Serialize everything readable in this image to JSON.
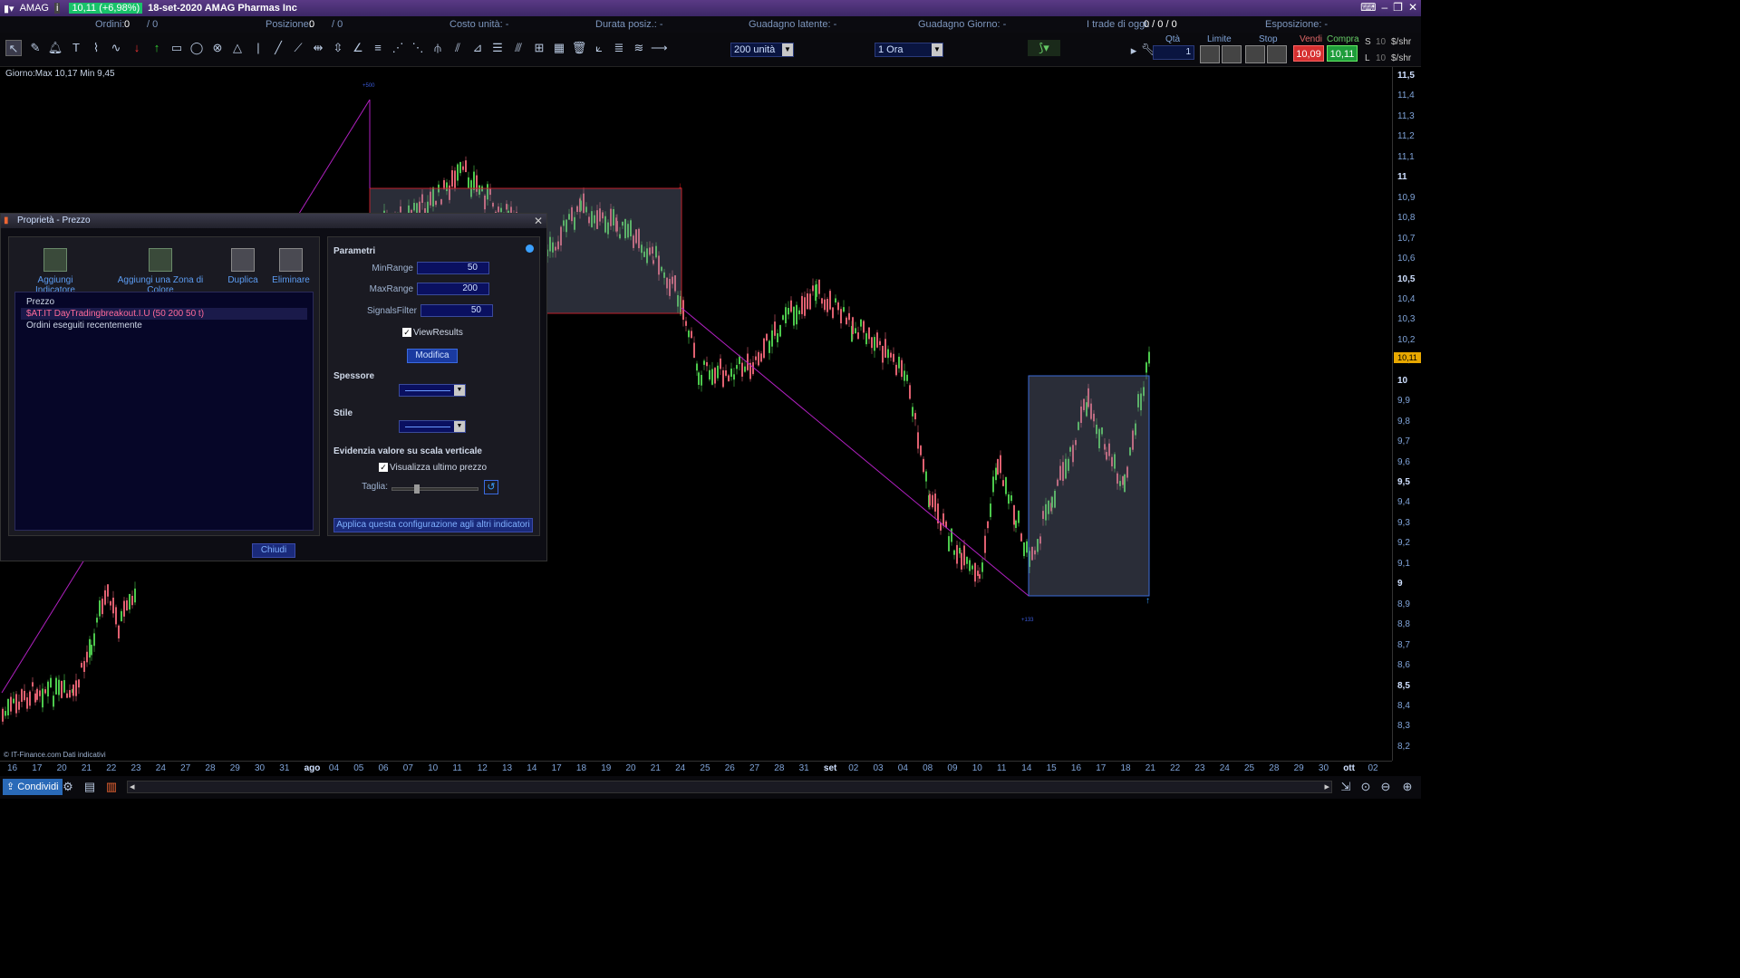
{
  "titlebar": {
    "symbol": "AMAG",
    "price_change": "10,11 (+6,98%)",
    "title": "18-set-2020 AMAG Pharmas Inc"
  },
  "statusbar": {
    "orders_label": "Ordini:",
    "orders_value": "0",
    "orders_total": "/ 0",
    "position_label": "Posizione:",
    "position_value": "0",
    "position_total": "/ 0",
    "unit_cost": "Costo unità: -",
    "duration": "Durata posiz.: -",
    "unrealized": "Guadagno latente: -",
    "day_gain": "Guadagno Giorno: -",
    "trades_label": "I trade di oggi:",
    "trades_value": "0 / 0 / 0",
    "exposure": "Esposizione: -"
  },
  "toolbar": {
    "units_value": "200 unità",
    "timeframe_value": "1 Ora"
  },
  "order_panel": {
    "qty_label": "Qtà",
    "qty_value": "1",
    "limit_label": "Limite",
    "stop_label": "Stop",
    "sell_label": "Vendi",
    "sell_price": "10,09",
    "buy_label": "Compra",
    "buy_price": "10,11",
    "s_label": "S",
    "l_label": "L",
    "s_qty": "10",
    "l_qty": "10",
    "unit": "$/shr"
  },
  "chart": {
    "info": "Giorno:Max 10,17 Min 9,45",
    "copyright": "© IT-Finance.com Dati indicativi",
    "last_price": "10,11",
    "signal_top": "+500",
    "signal_bottom": "+133"
  },
  "yaxis": [
    "11,5",
    "11,4",
    "11,3",
    "11,2",
    "11,1",
    "11",
    "10,9",
    "10,8",
    "10,7",
    "10,6",
    "10,5",
    "10,4",
    "10,3",
    "10,2",
    "10,1",
    "10",
    "9,9",
    "9,8",
    "9,7",
    "9,6",
    "9,5",
    "9,4",
    "9,3",
    "9,2",
    "9,1",
    "9",
    "8,9",
    "8,8",
    "8,7",
    "8,6",
    "8,5",
    "8,4",
    "8,3",
    "8,2"
  ],
  "xaxis": [
    "16",
    "17",
    "20",
    "21",
    "22",
    "23",
    "24",
    "27",
    "28",
    "29",
    "30",
    "31",
    "ago",
    "04",
    "05",
    "06",
    "07",
    "10",
    "11",
    "12",
    "13",
    "14",
    "17",
    "18",
    "19",
    "20",
    "21",
    "24",
    "25",
    "26",
    "27",
    "28",
    "31",
    "set",
    "02",
    "03",
    "04",
    "08",
    "09",
    "10",
    "11",
    "14",
    "15",
    "16",
    "17",
    "18",
    "21",
    "22",
    "23",
    "24",
    "25",
    "28",
    "29",
    "30",
    "ott",
    "02"
  ],
  "bottombar": {
    "share_label": "Condividi"
  },
  "dialog": {
    "title": "Proprietà - Prezzo",
    "buttons": {
      "add_indicator": "Aggiungi Indicatore",
      "add_zone": "Aggiungi una Zona di Colore",
      "duplicate": "Duplica",
      "delete": "Eliminare"
    },
    "tree": [
      "Prezzo",
      "$AT.IT DayTradingbreakout.I.U (50 200 50 t)",
      "Ordini eseguiti recentemente"
    ],
    "params_title": "Parametri",
    "params": [
      {
        "label": "MinRange",
        "value": "50"
      },
      {
        "label": "MaxRange",
        "value": "200"
      },
      {
        "label": "SignalsFilter",
        "value": "50"
      }
    ],
    "view_results": "ViewResults",
    "modify": "Modifica",
    "thickness": "Spessore",
    "style": "Stile",
    "highlight_title": "Evidenzia valore su scala verticale",
    "show_last": "Visualizza ultimo prezzo",
    "size": "Taglia:",
    "apply": "Applica questa configurazione agli altri indicatori",
    "close": "Chiudi"
  }
}
